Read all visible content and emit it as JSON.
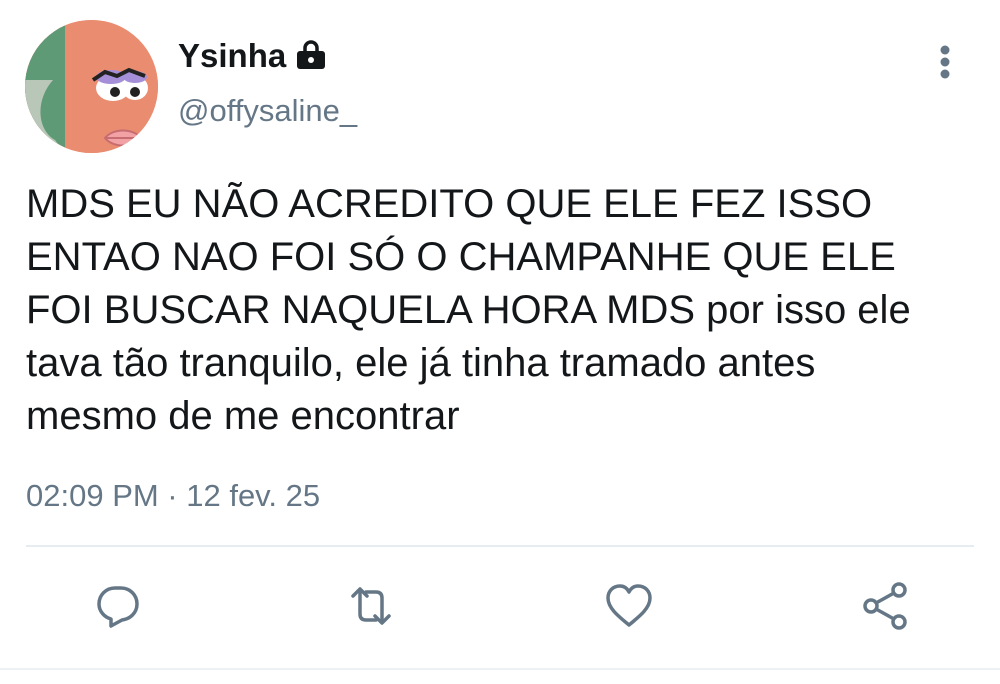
{
  "user": {
    "display_name": "Ysinha",
    "handle": "@offysaline_",
    "avatar": "avatar",
    "protected_icon": "lock-icon"
  },
  "tweet": {
    "text": "MDS EU NÃO ACREDITO QUE ELE FEZ ISSO\nENTAO NAO FOI SÓ O CHAMPANHE QUE ELE\nFOI BUSCAR NAQUELA HORA MDS por isso ele\ntava tão tranquilo, ele já tinha tramado antes\nmesmo de me encontrar",
    "timestamp": "02:09 PM · 12 fev. 25"
  },
  "actions": {
    "reply_icon": "reply-icon",
    "retweet_icon": "retweet-icon",
    "like_icon": "heart-icon",
    "share_icon": "share-icon",
    "more_icon": "more-vertical-icon"
  },
  "colors": {
    "text": "#14171a",
    "secondary": "#657786",
    "divider": "#e6ecf0"
  }
}
